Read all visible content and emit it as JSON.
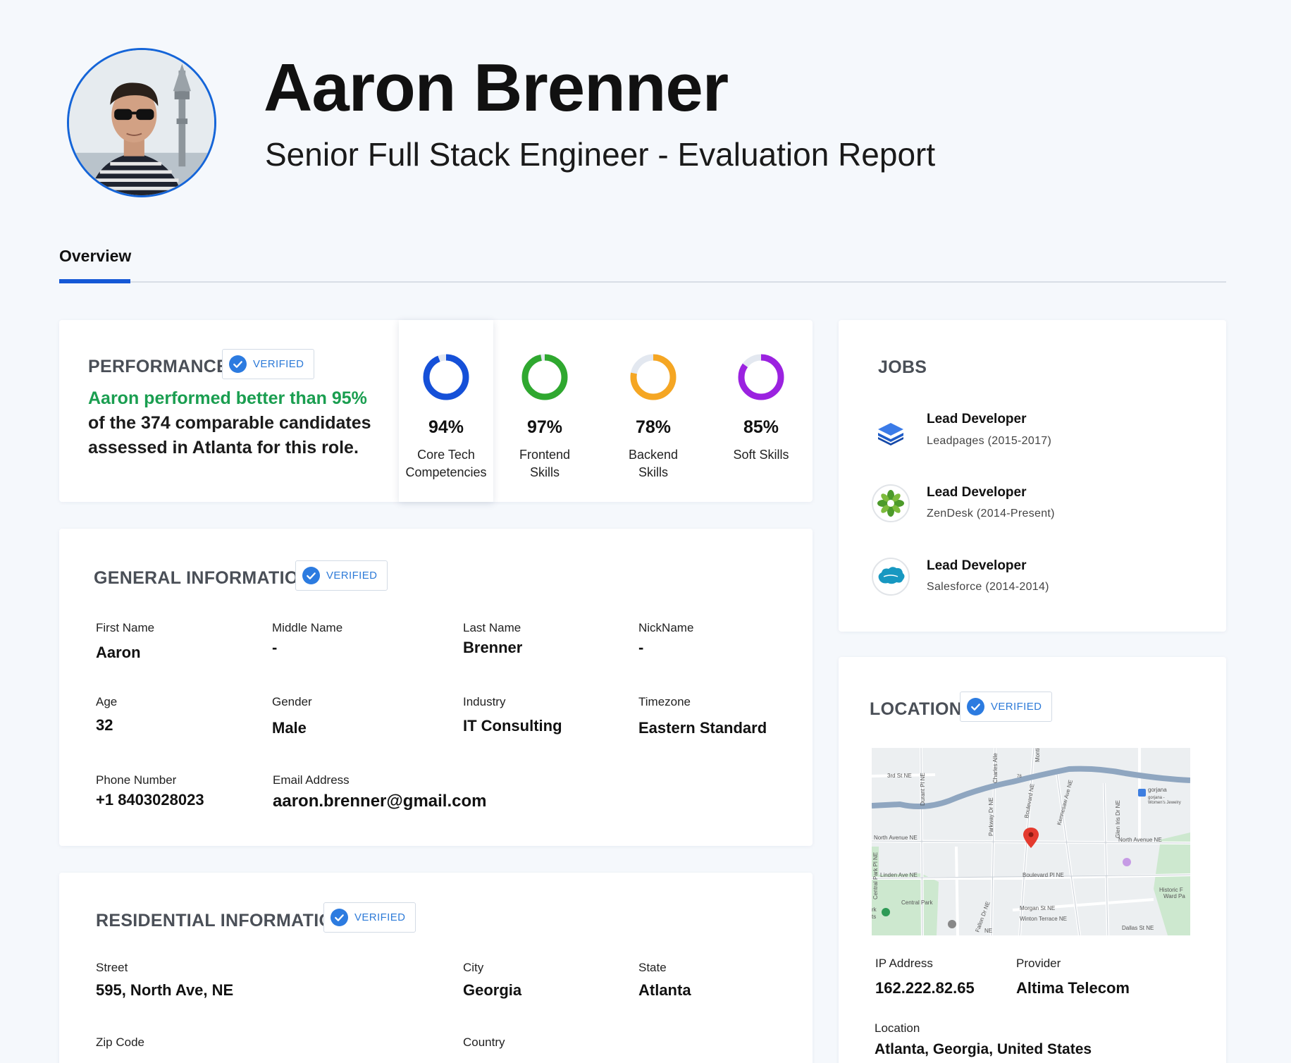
{
  "header": {
    "name": "Aaron Brenner",
    "subtitle": "Senior Full Stack Engineer - Evaluation Report"
  },
  "tabs": [
    {
      "label": "Overview",
      "active": true
    }
  ],
  "verified_label": "VERIFIED",
  "performance": {
    "title": "PERFORMANCE",
    "summary_highlight": "Aaron performed better than 95%",
    "summary_rest_1": " of",
    "summary_rest_2": "the 374 comparable candidates assessed in Atlanta for this role.",
    "metrics": [
      {
        "pct": "94%",
        "label_1": "Core Tech",
        "label_2": "Competencies",
        "value": 94,
        "color": "#1550d8"
      },
      {
        "pct": "97%",
        "label_1": "Frontend",
        "label_2": "Skills",
        "value": 97,
        "color": "#2fa82f"
      },
      {
        "pct": "78%",
        "label_1": "Backend",
        "label_2": "Skills",
        "value": 78,
        "color": "#f5a623"
      },
      {
        "pct": "85%",
        "label_1": "Soft Skills",
        "label_2": "",
        "value": 85,
        "color": "#9b22e0"
      }
    ]
  },
  "jobs": {
    "title": "JOBS",
    "items": [
      {
        "title": "Lead Developer",
        "sub": "Leadpages (2015-2017)",
        "icon": "leadpages-logo-icon"
      },
      {
        "title": "Lead Developer",
        "sub": "ZenDesk (2014-Present)",
        "icon": "zendesk-logo-icon"
      },
      {
        "title": "Lead Developer",
        "sub": "Salesforce (2014-2014)",
        "icon": "salesforce-logo-icon"
      }
    ]
  },
  "general": {
    "title": "GENERAL INFORMATION",
    "first_name": {
      "label": "First Name",
      "value": "Aaron"
    },
    "middle_name": {
      "label": "Middle Name",
      "value": "-"
    },
    "last_name": {
      "label": "Last Name",
      "value": "Brenner"
    },
    "nickname": {
      "label": "NickName",
      "value": "-"
    },
    "age": {
      "label": "Age",
      "value": "32"
    },
    "gender": {
      "label": "Gender",
      "value": "Male"
    },
    "industry": {
      "label": "Industry",
      "value": "IT Consulting"
    },
    "timezone": {
      "label": "Timezone",
      "value": "Eastern Standard"
    },
    "phone": {
      "label": "Phone Number",
      "value": "+1 8403028023"
    },
    "email": {
      "label": "Email Address",
      "value": "aaron.brenner@gmail.com"
    }
  },
  "residential": {
    "title": "RESIDENTIAL INFORMATION",
    "street": {
      "label": "Street",
      "value": "595, North Ave, NE"
    },
    "city": {
      "label": "City",
      "value": "Georgia"
    },
    "state": {
      "label": "State",
      "value": "Atlanta"
    },
    "zip": {
      "label": "Zip Code"
    },
    "country": {
      "label": "Country"
    }
  },
  "location": {
    "title": "LOCATION",
    "ip": {
      "label": "IP Address",
      "value": "162.222.82.65"
    },
    "provider": {
      "label": "Provider",
      "value": "Altima Telecom"
    },
    "place": {
      "label": "Location",
      "value": "Atlanta, Georgia, United States"
    },
    "map_labels": {
      "third_st": "3rd St NE",
      "durant": "Durant Pl NE",
      "charles": "Charles Alle",
      "monti": "Monti",
      "parkway": "Parkway Dr NE",
      "boulevard": "Boulevard NE",
      "kennesaw": "Kennesaw Ave NE",
      "glen_iris": "Glen Iris Dr NE",
      "north_ave_w": "North Avenue NE",
      "north_ave_e": "North Avenue NE",
      "central_park_pl": "Central Park Pl NE",
      "linden": "Linden Ave NE",
      "boulevard_pl": "Boulevard Pl NE",
      "central_park": "Central Park",
      "morgan": "Morgan St NE",
      "winton": "Winton Terrace NE",
      "dallas": "Dallas St NE",
      "historic": "Historic F",
      "ward": "Ward Pa",
      "gorjana": "gorjana",
      "gorjana_sub": "gorjana -",
      "gorjana_sub2": "Women's Jewelry",
      "route": "78",
      "fallon": "Fallon Dr NE",
      "rk": "rk",
      "ts": "ts",
      "ne": "NE"
    }
  },
  "colors": {
    "accent": "#1558d6",
    "green_text": "#1a9e50",
    "verified_text": "#2e7bd8"
  }
}
